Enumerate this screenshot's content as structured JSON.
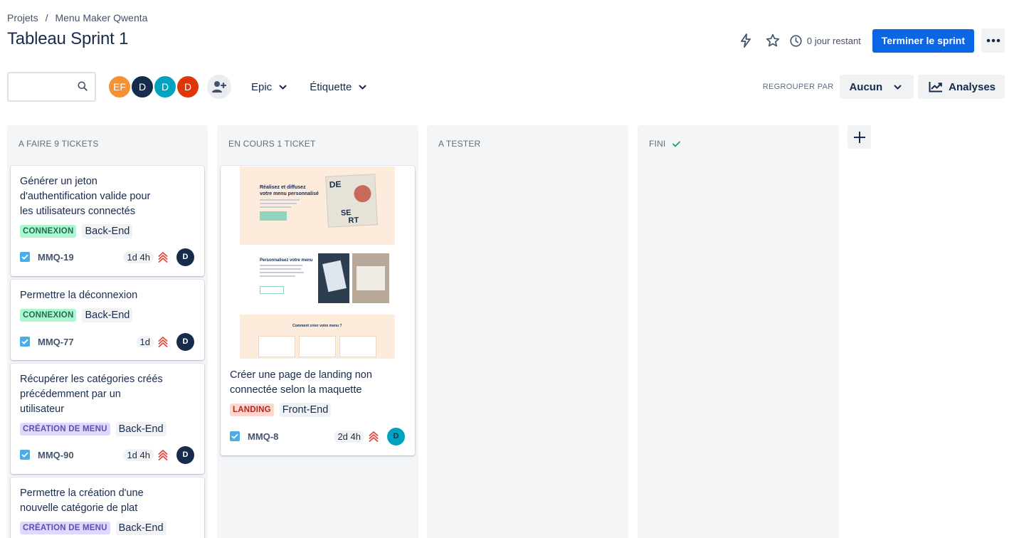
{
  "breadcrumb": {
    "root": "Projets",
    "separator": "/",
    "project": "Menu Maker Qwenta"
  },
  "page_title": "Tableau Sprint 1",
  "header": {
    "days_left": "0 jour restant",
    "complete_sprint": "Terminer le sprint",
    "icons": [
      "lightning-icon",
      "star-icon",
      "clock-icon",
      "more-icon"
    ]
  },
  "toolbar": {
    "search_value": "",
    "avatars": [
      {
        "initials": "EF",
        "color": "#f79232"
      },
      {
        "initials": "D",
        "color": "#172b4d"
      },
      {
        "initials": "D",
        "color": "#00a3bf"
      },
      {
        "initials": "D",
        "color": "#de350b"
      }
    ],
    "epic_filter": "Epic",
    "label_filter": "Étiquette",
    "group_by_label": "REGROUPER PAR",
    "group_by_value": "Aucun",
    "insights": "Analyses"
  },
  "columns": [
    {
      "title": "A FAIRE 9 TICKETS"
    },
    {
      "title": "EN COURS 1 TICKET"
    },
    {
      "title": "A TESTER"
    },
    {
      "title": "FINI"
    }
  ],
  "cards": [
    {
      "title_lines": [
        "Générer un jeton",
        "d'authentification valide pour",
        "les utilisateurs connectés"
      ],
      "epic": "CONNEXION",
      "tag": "Back-End",
      "key": "MMQ-19",
      "estimate": "1d 4h",
      "assignee": "D"
    },
    {
      "title_lines": [
        "Permettre la déconnexion"
      ],
      "epic": "CONNEXION",
      "tag": "Back-End",
      "key": "MMQ-77",
      "estimate": "1d",
      "assignee": "D"
    },
    {
      "title_lines": [
        "Récupérer les catégories créés",
        "précédemment par un",
        "utilisateur"
      ],
      "epic": "CRÉATION DE MENU",
      "tag": "Back-End",
      "key": "MMQ-90",
      "estimate": "1d 4h",
      "assignee": "D"
    },
    {
      "title_lines": [
        "Permettre la création d'une",
        "nouvelle catégorie de plat"
      ],
      "epic": "CRÉATION DE MENU",
      "tag": "Back-End"
    },
    {
      "title_lines": [
        "Créer une page de landing non",
        "connectée selon la maquette"
      ],
      "epic": "LANDING",
      "tag": "Front-End",
      "key": "MMQ-8",
      "estimate": "2d 4h",
      "assignee": "D"
    }
  ],
  "landing_preview": {
    "hero_title": [
      "Réalisez et diffusez",
      "votre menu personnalisé"
    ],
    "section2_title": "Personnalisez votre menu",
    "section3_title": "Comment créer votre menu ?",
    "brand_letters": [
      "DE",
      "SE",
      "RT"
    ]
  },
  "colors": {
    "primary": "#0c66e4",
    "epic_connexion_bg": "#abf5d1",
    "epic_menu_bg": "#dfd8fd",
    "epic_landing_bg": "#ffd5d2",
    "priority": "#e2483d"
  }
}
